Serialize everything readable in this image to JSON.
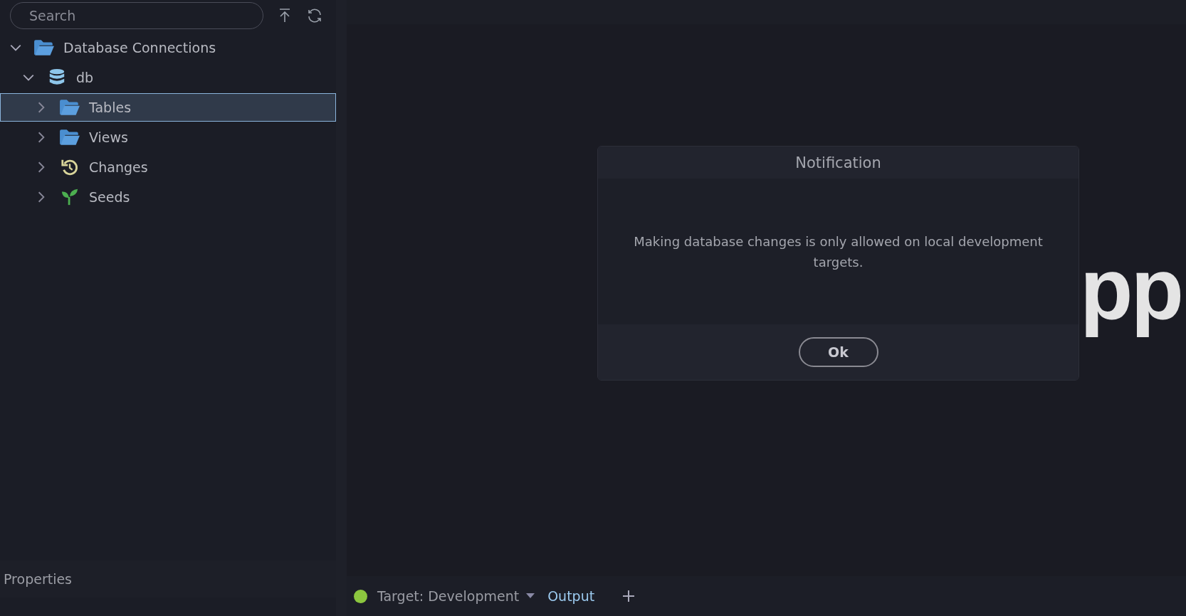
{
  "sidebar": {
    "search": {
      "placeholder": "Search"
    },
    "tree": [
      {
        "label": "Database Connections",
        "kind": "folder",
        "expanded": true,
        "selected": false,
        "children": [
          {
            "label": "db",
            "kind": "database",
            "expanded": true,
            "selected": false,
            "children": [
              {
                "label": "Tables",
                "kind": "folder",
                "expanded": false,
                "selected": true
              },
              {
                "label": "Views",
                "kind": "folder",
                "expanded": false,
                "selected": false
              },
              {
                "label": "Changes",
                "kind": "history",
                "expanded": false,
                "selected": false
              },
              {
                "label": "Seeds",
                "kind": "seedling",
                "expanded": false,
                "selected": false
              }
            ]
          }
        ]
      }
    ],
    "properties": {
      "title": "Properties"
    }
  },
  "main": {
    "logo_text": "pp"
  },
  "dialog": {
    "title": "Notification",
    "message": "Making database changes is only allowed on local development targets.",
    "button": "Ok"
  },
  "status_bar": {
    "target": {
      "label": "Target: Development",
      "color": "#8cc63f"
    },
    "tabs": [
      {
        "label": "Output",
        "selected": true
      }
    ]
  }
}
